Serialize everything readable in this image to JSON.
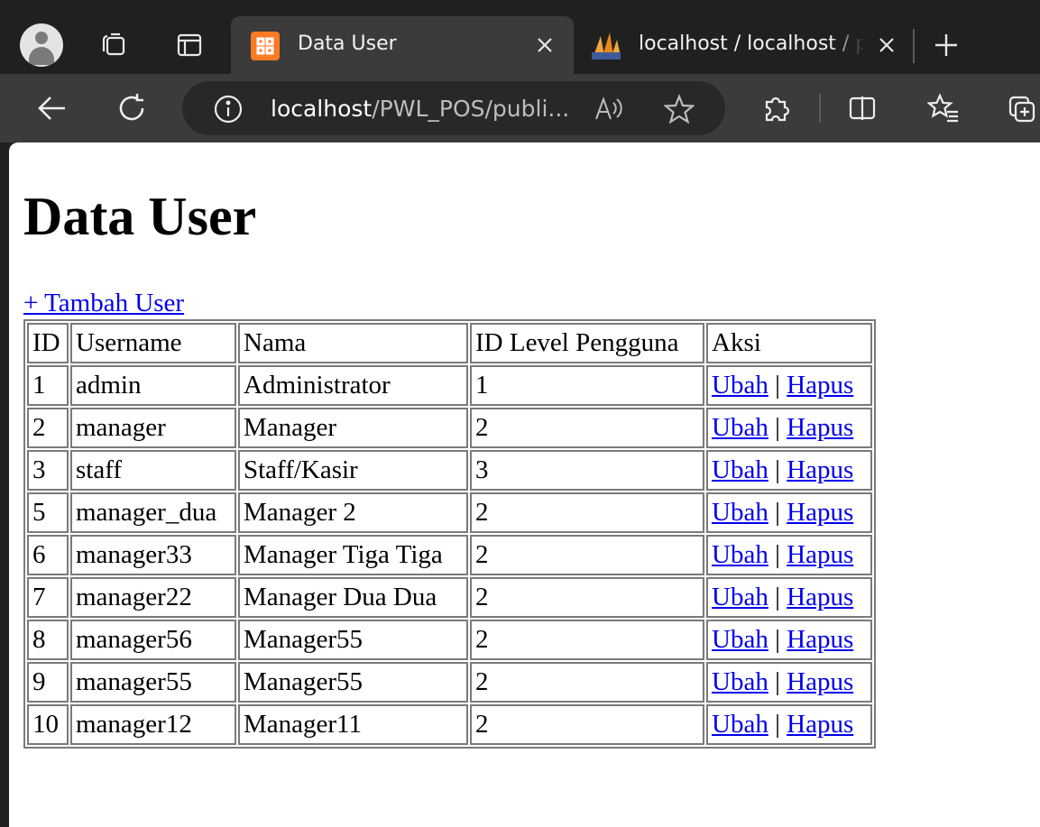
{
  "browser": {
    "tabs": [
      {
        "title": "Data User",
        "active": true,
        "icon": "xampp-icon"
      },
      {
        "title": "localhost / localhost / phpMyAdmin",
        "active": false,
        "icon": "phpmyadmin-icon"
      }
    ],
    "address": {
      "host": "localhost",
      "path": "/PWL_POS/publi...",
      "icons": [
        "info-icon",
        "read-aloud-icon",
        "favorite-star-icon"
      ]
    },
    "toolbar_icons": [
      "back-icon",
      "refresh-icon",
      "extensions-icon",
      "split-screen-icon",
      "favorites-icon",
      "collections-icon"
    ],
    "colors": {
      "tabstrip": "#202020",
      "toolbar": "#3b3b3b",
      "address_bar": "#282828",
      "xampp_orange": "#fb7a24"
    }
  },
  "page": {
    "title": "Data User",
    "add_link": "+ Tambah User",
    "link_color": "#0000ee",
    "table": {
      "headers": [
        "ID",
        "Username",
        "Nama",
        "ID Level Pengguna",
        "Aksi"
      ],
      "rows": [
        {
          "id": "1",
          "username": "admin",
          "nama": "Administrator",
          "level": "1"
        },
        {
          "id": "2",
          "username": "manager",
          "nama": "Manager",
          "level": "2"
        },
        {
          "id": "3",
          "username": "staff",
          "nama": "Staff/Kasir",
          "level": "3"
        },
        {
          "id": "5",
          "username": "manager_dua",
          "nama": "Manager 2",
          "level": "2"
        },
        {
          "id": "6",
          "username": "manager33",
          "nama": "Manager Tiga Tiga",
          "level": "2"
        },
        {
          "id": "7",
          "username": "manager22",
          "nama": "Manager Dua Dua",
          "level": "2"
        },
        {
          "id": "8",
          "username": "manager56",
          "nama": "Manager55",
          "level": "2"
        },
        {
          "id": "9",
          "username": "manager55",
          "nama": "Manager55",
          "level": "2"
        },
        {
          "id": "10",
          "username": "manager12",
          "nama": "Manager11",
          "level": "2"
        }
      ],
      "action_edit": "Ubah",
      "action_separator": "|",
      "action_delete": "Hapus"
    }
  }
}
